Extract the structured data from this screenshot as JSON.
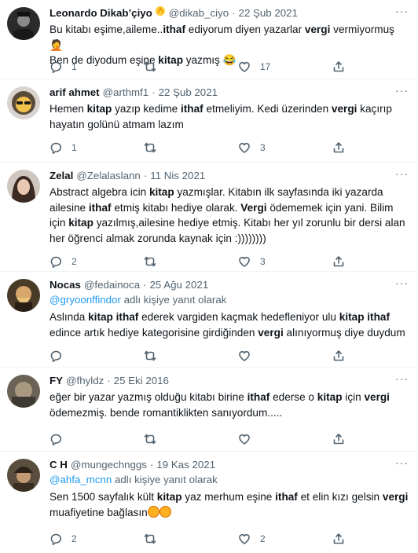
{
  "tweets": [
    {
      "name": "Leonardo Dikab’çiyo",
      "badge_icon": "sparkle-emoji",
      "handle": "@dikab_ciyo",
      "sep": "·",
      "date": "22 Şub 2021",
      "text_parts": [
        {
          "t": "Bu kitabı eşime,aileme..",
          "b": false
        },
        {
          "t": "ithaf",
          "b": true
        },
        {
          "t": " ediyorum diyen yazarlar ",
          "b": false
        },
        {
          "t": "vergi",
          "b": true
        },
        {
          "t": " vermiyormuş ",
          "b": false
        },
        {
          "t": "🤦",
          "b": false
        },
        {
          "br": true
        },
        {
          "t": "Ben de diyodum eşine ",
          "b": false
        },
        {
          "t": "kitap",
          "b": true
        },
        {
          "t": " yazmış ",
          "b": false
        },
        {
          "t": "😂",
          "b": false
        }
      ],
      "replies": "1",
      "retweets": "",
      "likes": "17"
    },
    {
      "name": "arif ahmet",
      "handle": "@arthmf1",
      "sep": "·",
      "date": "22 Şub 2021",
      "text_parts": [
        {
          "t": "Hemen ",
          "b": false
        },
        {
          "t": "kitap",
          "b": true
        },
        {
          "t": " yazıp kedime ",
          "b": false
        },
        {
          "t": "ithaf",
          "b": true
        },
        {
          "t": " etmeliyim. Kedi üzerinden ",
          "b": false
        },
        {
          "t": "vergi",
          "b": true
        },
        {
          "t": " kaçırıp hayatın golünü atmam lazım",
          "b": false
        }
      ],
      "replies": "1",
      "retweets": "",
      "likes": "3"
    },
    {
      "name": "Zelal",
      "handle": "@Zelalaslann",
      "sep": "·",
      "date": "11 Nis 2021",
      "text_parts": [
        {
          "t": "Abstract algebra icin ",
          "b": false
        },
        {
          "t": "kitap",
          "b": true
        },
        {
          "t": " yazmışlar. Kitabın ilk sayfasında iki yazarda ailesine ",
          "b": false
        },
        {
          "t": "ithaf",
          "b": true
        },
        {
          "t": " etmiş kitabı hediye olarak. ",
          "b": false
        },
        {
          "t": "Vergi",
          "b": true
        },
        {
          "t": " ödememek için yani. Bilim için ",
          "b": false
        },
        {
          "t": "kitap",
          "b": true
        },
        {
          "t": " yazılmış,ailesine hediye etmiş. Kitabı her yıl zorunlu bir dersi alan her öğrenci almak zorunda  kaynak için :))))))))",
          "b": false
        }
      ],
      "replies": "2",
      "retweets": "",
      "likes": "3"
    },
    {
      "name": "Nocas",
      "handle": "@fedainoca",
      "sep": "·",
      "date": "25 Ağu 2021",
      "reply_mention": "@gryoonffindor",
      "reply_suffix": " adlı kişiye yanıt olarak",
      "text_parts": [
        {
          "t": "Aslında ",
          "b": false
        },
        {
          "t": "kitap",
          "b": true
        },
        {
          "t": " ",
          "b": false
        },
        {
          "t": "ithaf",
          "b": true
        },
        {
          "t": " ederek vargiden kaçmak hedefleniyor ulu ",
          "b": false
        },
        {
          "t": "kitap",
          "b": true
        },
        {
          "t": " ",
          "b": false
        },
        {
          "t": "ithaf",
          "b": true
        },
        {
          "t": " edince artık hediye kategorisine girdiğinden ",
          "b": false
        },
        {
          "t": "vergi",
          "b": true
        },
        {
          "t": " alınıyormuş diye duydum",
          "b": false
        }
      ],
      "replies": "",
      "retweets": "",
      "likes": ""
    },
    {
      "name": "FY",
      "handle": "@fhyldz",
      "sep": "·",
      "date": "25 Eki 2016",
      "text_parts": [
        {
          "t": "eğer bir yazar yazmış olduğu kitabı birine ",
          "b": false
        },
        {
          "t": "ithaf",
          "b": true
        },
        {
          "t": " ederse o ",
          "b": false
        },
        {
          "t": "kitap",
          "b": true
        },
        {
          "t": " için ",
          "b": false
        },
        {
          "t": "vergi",
          "b": true
        },
        {
          "t": " ödemezmiş. bende romantiklikten sanıyordum.....",
          "b": false
        }
      ],
      "replies": "",
      "retweets": "",
      "likes": ""
    },
    {
      "name": "C H",
      "handle": "@mungechnggs",
      "sep": "·",
      "date": "19 Kas 2021",
      "reply_mention": "@ahfa_mcnn",
      "reply_suffix": " adlı kişiye yanıt olarak",
      "text_parts": [
        {
          "t": "Sen 1500 sayfalık kült ",
          "b": false
        },
        {
          "t": "kitap",
          "b": true
        },
        {
          "t": " yaz merhum eşine ",
          "b": false
        },
        {
          "t": "ithaf",
          "b": true
        },
        {
          "t": " et elin kızı gelsin ",
          "b": false
        },
        {
          "t": "vergi",
          "b": true
        },
        {
          "t": " muafiyetine bağlasın",
          "b": false
        },
        {
          "emoji": "sad"
        },
        {
          "emoji": "sad"
        }
      ],
      "replies": "2",
      "retweets": "",
      "likes": "2"
    }
  ],
  "more_label": "···",
  "colors": {
    "accent": "#1d9bf0",
    "muted": "#536471",
    "text": "#0f1419",
    "divider": "#eff3f4"
  }
}
